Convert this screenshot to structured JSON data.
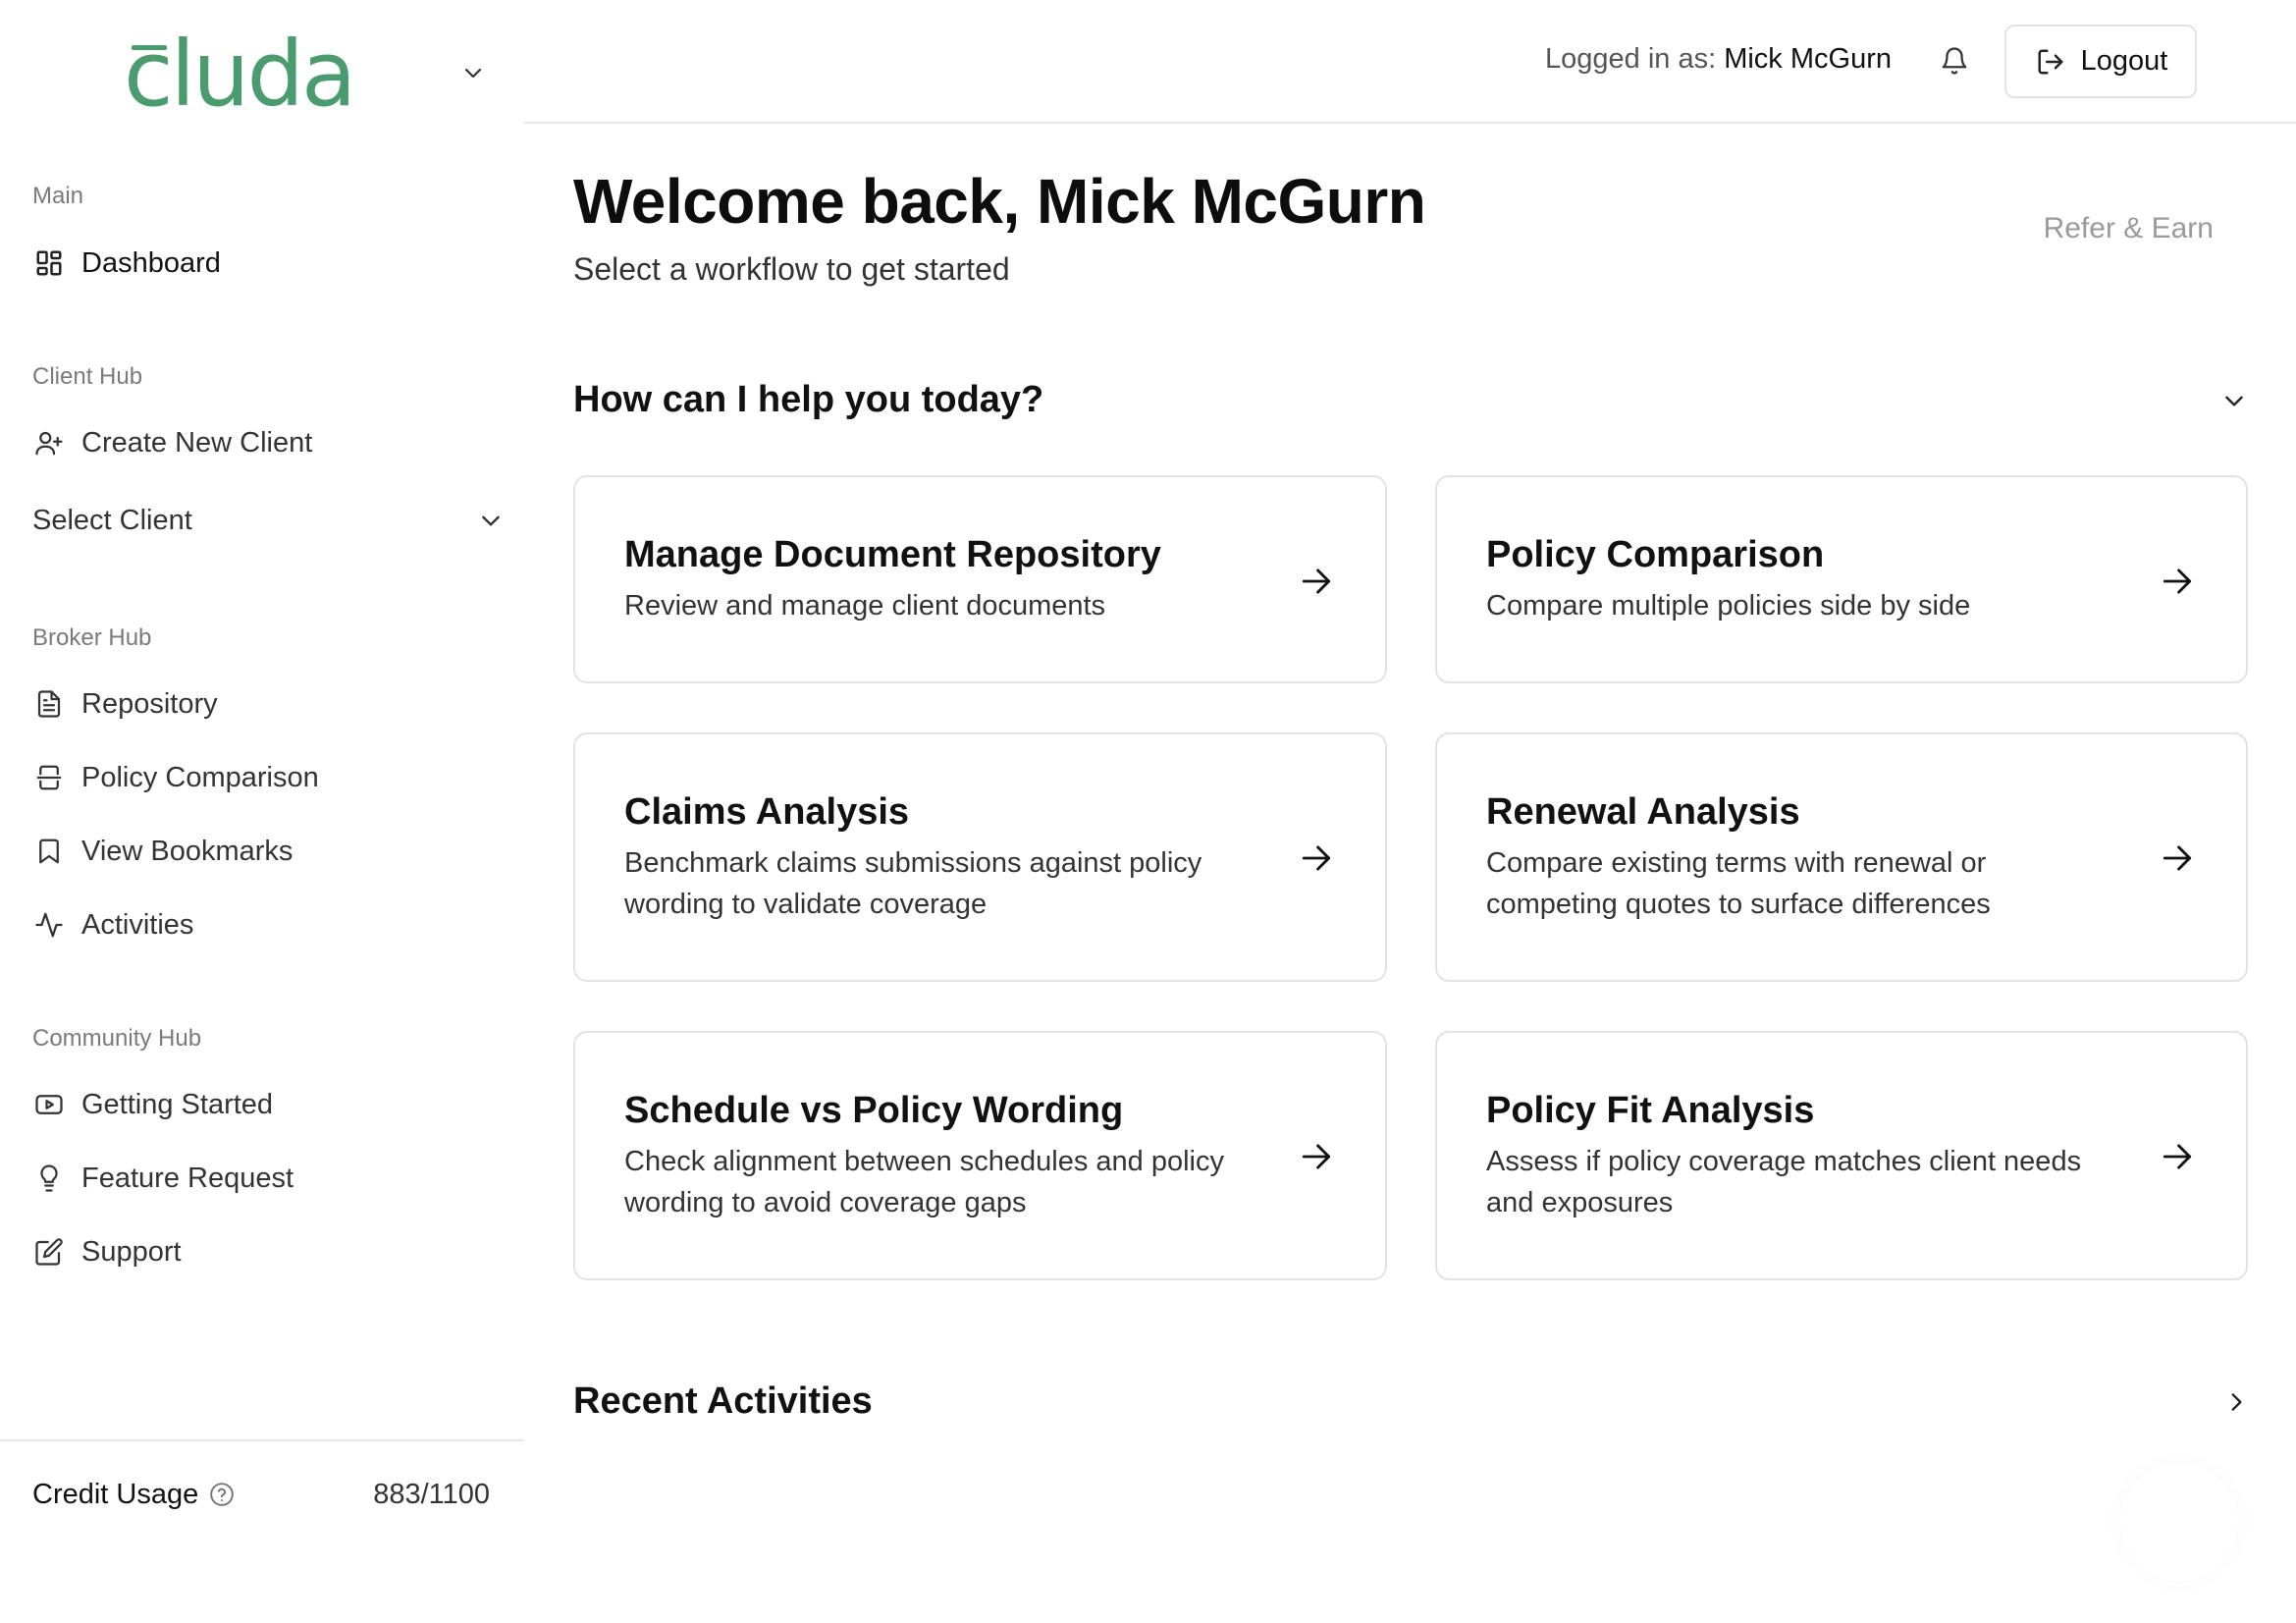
{
  "brand": {
    "logo_text": "cluda",
    "accent": "#4a9c6e"
  },
  "sidebar": {
    "sections": {
      "main": "Main",
      "client_hub": "Client Hub",
      "broker_hub": "Broker Hub",
      "community_hub": "Community Hub"
    },
    "main_items": [
      {
        "label": "Dashboard",
        "icon": "dashboard-grid-icon"
      }
    ],
    "client_items": [
      {
        "label": "Create New Client",
        "icon": "user-plus-icon"
      }
    ],
    "select_client": {
      "label": "Select Client",
      "icon": "chevron-down-icon"
    },
    "broker_items": [
      {
        "label": "Repository",
        "icon": "document-icon"
      },
      {
        "label": "Policy Comparison",
        "icon": "compare-icon"
      },
      {
        "label": "View Bookmarks",
        "icon": "bookmark-icon"
      },
      {
        "label": "Activities",
        "icon": "activity-icon"
      }
    ],
    "community_items": [
      {
        "label": "Getting Started",
        "icon": "play-video-icon"
      },
      {
        "label": "Feature Request",
        "icon": "lightbulb-icon"
      },
      {
        "label": "Support",
        "icon": "edit-icon"
      }
    ],
    "credit": {
      "label": "Credit Usage",
      "value": "883/1100"
    }
  },
  "header": {
    "logged_in_prefix": "Logged in as: ",
    "user_name": "Mick McGurn",
    "logout_label": "Logout"
  },
  "main": {
    "welcome": "Welcome back, Mick McGurn",
    "subtitle": "Select a workflow to get started",
    "refer": "Refer & Earn",
    "help_heading": "How can I help you today?",
    "cards": [
      {
        "title": "Manage Document Repository",
        "desc": "Review and manage client documents"
      },
      {
        "title": "Policy Comparison",
        "desc": "Compare multiple policies side by side"
      },
      {
        "title": "Claims Analysis",
        "desc": "Benchmark claims submissions against policy wording to validate coverage"
      },
      {
        "title": "Renewal Analysis",
        "desc": "Compare existing terms with renewal or competing quotes to surface differences"
      },
      {
        "title": "Schedule vs Policy Wording",
        "desc": "Check alignment between schedules and policy wording to avoid coverage gaps"
      },
      {
        "title": "Policy Fit Analysis",
        "desc": "Assess if policy coverage matches client needs and exposures"
      }
    ],
    "recent_heading": "Recent Activities"
  }
}
